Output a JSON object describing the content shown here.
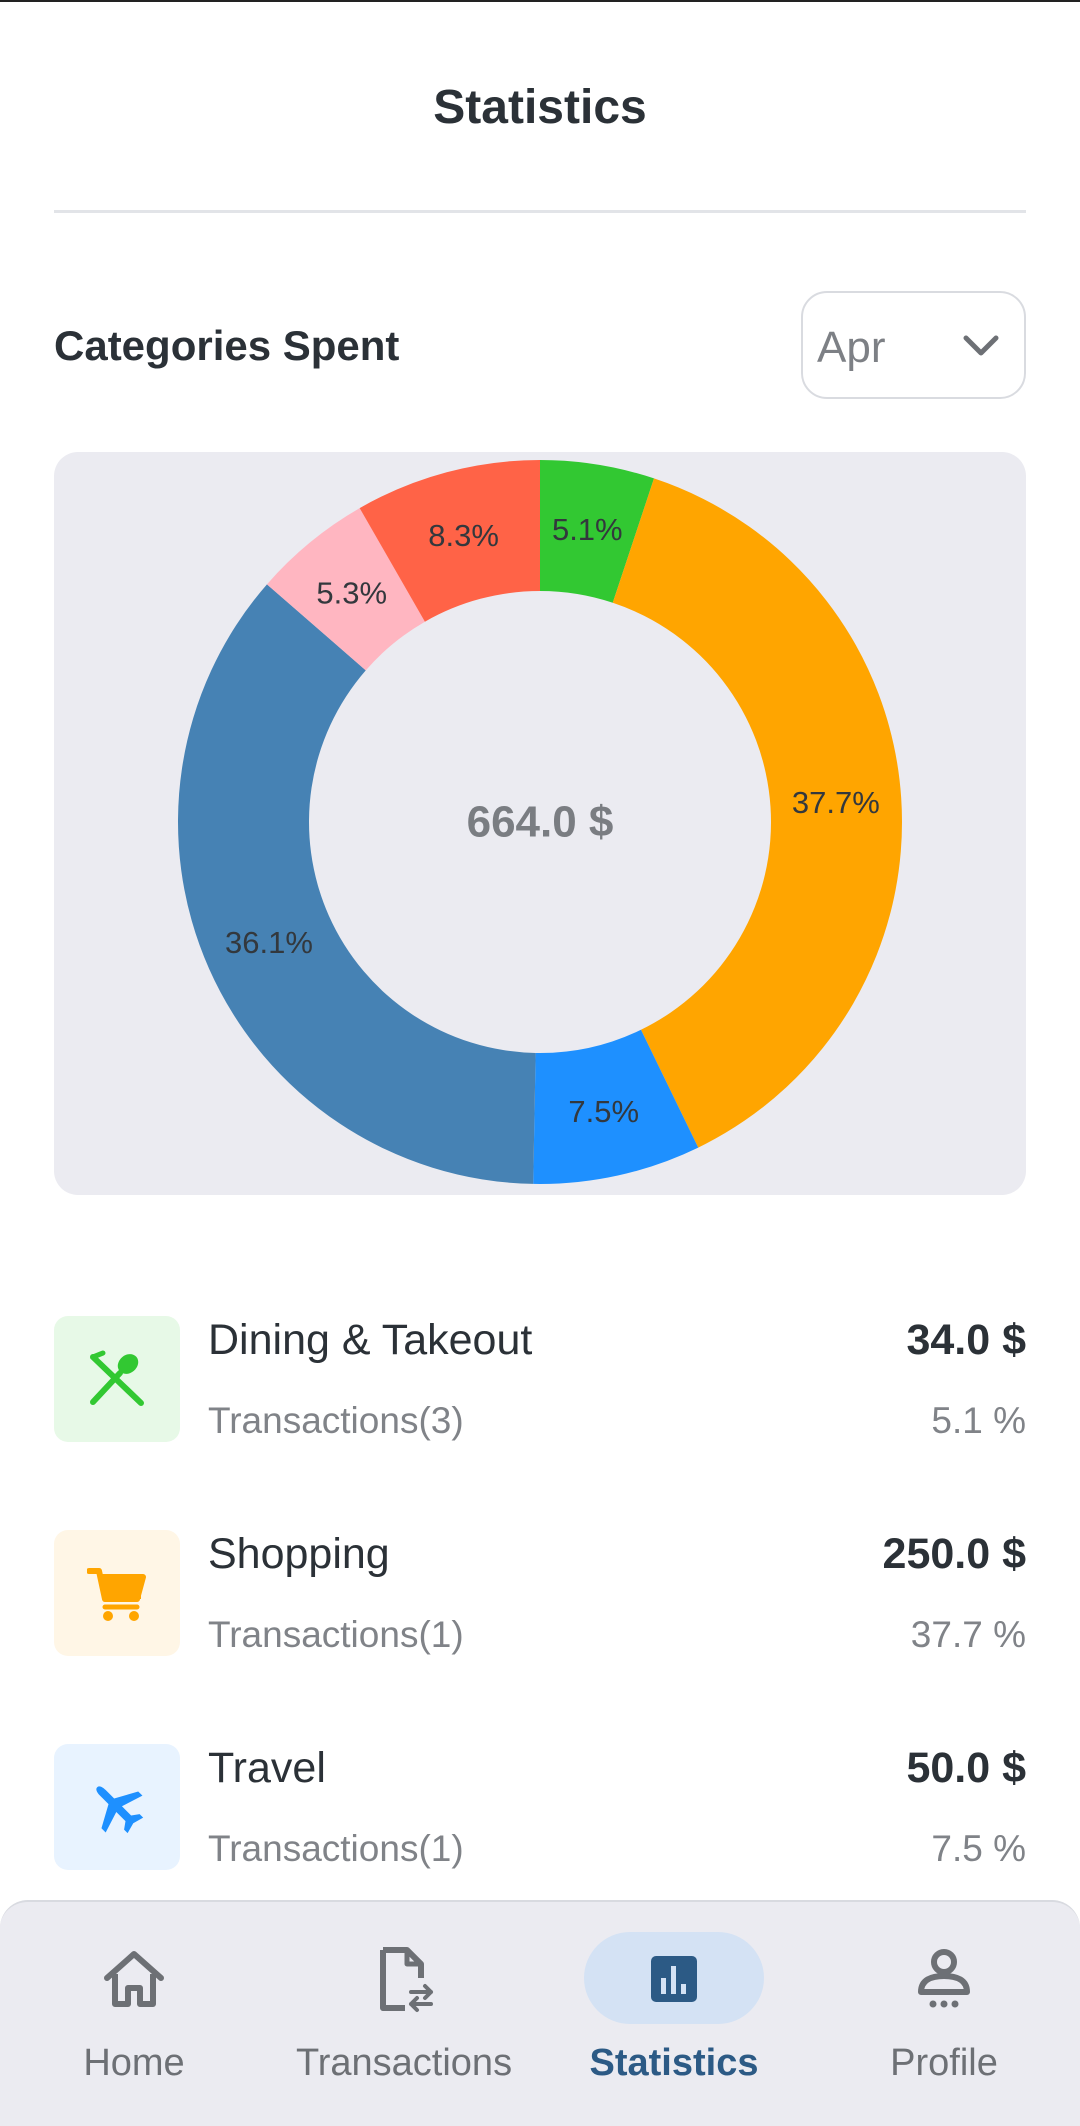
{
  "header": {
    "title": "Statistics"
  },
  "section": {
    "title": "Categories Spent",
    "month": "Apr"
  },
  "chart_data": {
    "type": "pie",
    "center_label": "664.0 $",
    "slices": [
      {
        "label": "5.1%",
        "value": 5.1,
        "color": "#32c832"
      },
      {
        "label": "37.7%",
        "value": 37.7,
        "color": "#ffa500"
      },
      {
        "label": "7.5%",
        "value": 7.5,
        "color": "#1e90ff"
      },
      {
        "label": "36.1%",
        "value": 36.1,
        "color": "#4682b4"
      },
      {
        "label": "5.3%",
        "value": 5.3,
        "color": "#ffb6c1"
      },
      {
        "label": "8.3%",
        "value": 8.3,
        "color": "#ff6347"
      }
    ]
  },
  "categories": [
    {
      "name": "Dining & Takeout",
      "transactions": "Transactions(3)",
      "amount": "34.0 $",
      "percent": "5.1 %",
      "icon": "fork-spoon-icon",
      "color": "#32c832",
      "bg": "#e7f9e7"
    },
    {
      "name": "Shopping",
      "transactions": "Transactions(1)",
      "amount": "250.0 $",
      "percent": "37.7 %",
      "icon": "cart-icon",
      "color": "#ffa500",
      "bg": "#fff6e6"
    },
    {
      "name": "Travel",
      "transactions": "Transactions(1)",
      "amount": "50.0 $",
      "percent": "7.5 %",
      "icon": "plane-icon",
      "color": "#1e90ff",
      "bg": "#e8f3ff"
    }
  ],
  "nav": {
    "items": [
      {
        "label": "Home",
        "icon": "home-icon"
      },
      {
        "label": "Transactions",
        "icon": "transactions-icon"
      },
      {
        "label": "Statistics",
        "icon": "statistics-icon",
        "active": true
      },
      {
        "label": "Profile",
        "icon": "profile-icon"
      }
    ]
  }
}
